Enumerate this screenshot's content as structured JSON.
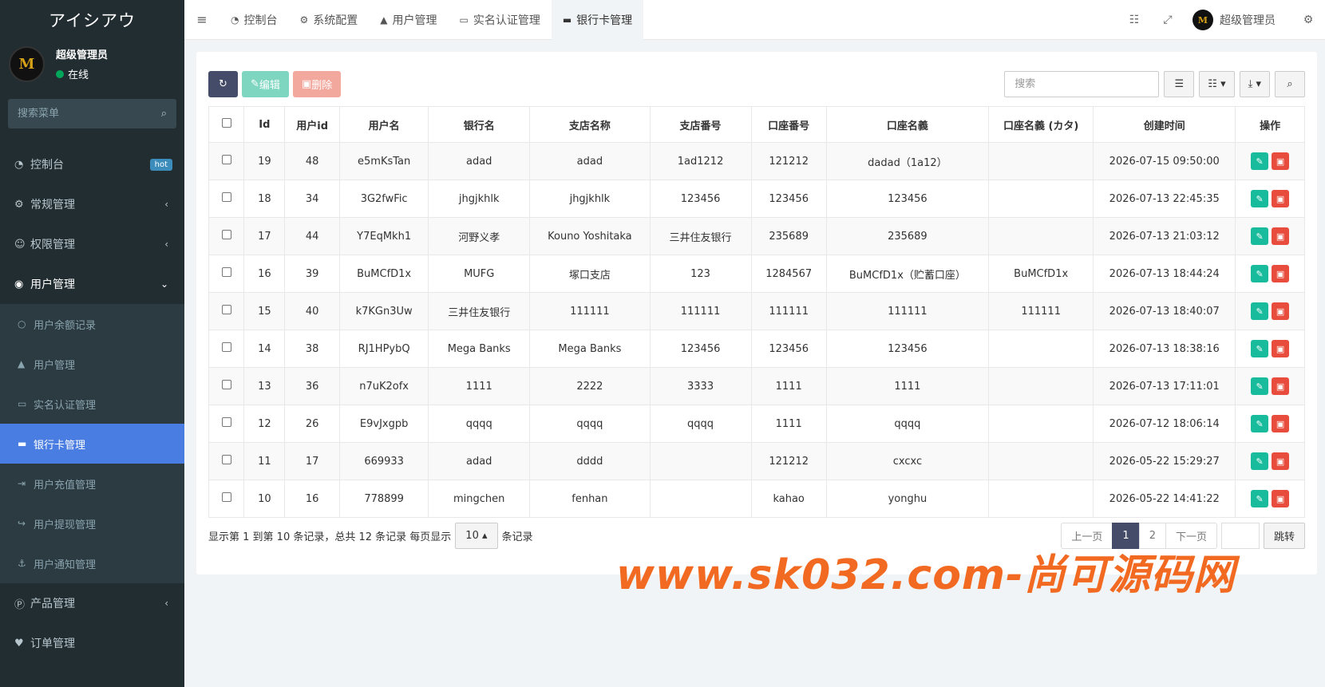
{
  "sidebar": {
    "brand": "アイシアウ",
    "avatar_text": "M",
    "user_name": "超级管理员",
    "user_status": "在线",
    "search_placeholder": "搜索菜单",
    "menu": {
      "dashboard": "控制台",
      "dashboard_badge": "hot",
      "general": "常规管理",
      "permission": "权限管理",
      "user_mgmt": "用户管理",
      "sub": {
        "balance": "用户余额记录",
        "users": "用户管理",
        "realname": "实名认证管理",
        "bankcard": "银行卡管理",
        "recharge": "用户充值管理",
        "withdraw": "用户提现管理",
        "notify": "用户通知管理"
      },
      "product": "产品管理",
      "orders": "订单管理"
    }
  },
  "navbar": {
    "tabs": [
      "控制台",
      "系统配置",
      "用户管理",
      "实名认证管理",
      "银行卡管理"
    ],
    "user_name": "超级管理员"
  },
  "toolbar": {
    "edit_label": "编辑",
    "delete_label": "删除",
    "search_placeholder": "搜索"
  },
  "table": {
    "headers": [
      "Id",
      "用户id",
      "用户名",
      "银行名",
      "支店名称",
      "支店番号",
      "口座番号",
      "口座名義",
      "口座名義 (カタ)",
      "创建时间",
      "操作"
    ],
    "rows": [
      [
        "19",
        "48",
        "e5mKsTan",
        "adad",
        "adad",
        "1ad1212",
        "121212",
        "dadad（1a12）",
        "",
        "2026-07-15 09:50:00"
      ],
      [
        "18",
        "34",
        "3G2fwFic",
        "jhgjkhlk",
        "jhgjkhlk",
        "123456",
        "123456",
        "123456",
        "",
        "2026-07-13 22:45:35"
      ],
      [
        "17",
        "44",
        "Y7EqMkh1",
        "河野义孝",
        "Kouno Yoshitaka",
        "三井住友银行",
        "235689",
        "235689",
        "",
        "2026-07-13 21:03:12"
      ],
      [
        "16",
        "39",
        "BuMCfD1x",
        "MUFG",
        "塚口支店",
        "123",
        "1284567",
        "BuMCfD1x（贮蓄口座）",
        "BuMCfD1x",
        "2026-07-13 18:44:24"
      ],
      [
        "15",
        "40",
        "k7KGn3Uw",
        "三井住友银行",
        "111111",
        "111111",
        "111111",
        "111111",
        "111111",
        "2026-07-13 18:40:07"
      ],
      [
        "14",
        "38",
        "RJ1HPybQ",
        "Mega Banks",
        "Mega Banks",
        "123456",
        "123456",
        "123456",
        "",
        "2026-07-13 18:38:16"
      ],
      [
        "13",
        "36",
        "n7uK2ofx",
        "1111",
        "2222",
        "3333",
        "1111",
        "1111",
        "",
        "2026-07-13 17:11:01"
      ],
      [
        "12",
        "26",
        "E9vJxgpb",
        "qqqq",
        "qqqq",
        "qqqq",
        "1111",
        "qqqq",
        "",
        "2026-07-12 18:06:14"
      ],
      [
        "11",
        "17",
        "669933",
        "adad",
        "dddd",
        "",
        "121212",
        "cxcxc",
        "",
        "2026-05-22 15:29:27"
      ],
      [
        "10",
        "16",
        "778899",
        "mingchen",
        "fenhan",
        "",
        "kahao",
        "yonghu",
        "",
        "2026-05-22 14:41:22"
      ]
    ]
  },
  "footer": {
    "info_prefix": "显示第 1 到第 10 条记录，总共 12 条记录 每页显示",
    "page_size": "10",
    "info_suffix": "条记录",
    "prev": "上一页",
    "pages": [
      "1",
      "2"
    ],
    "next": "下一页",
    "jump": "跳转"
  },
  "watermark": "www.sk032.com-尚可源码网",
  "colors": {
    "sidebar_bg": "#222d32",
    "active_menu": "#4a7de2",
    "primary_dark": "#444c69",
    "success": "#18bc9c",
    "danger": "#e74c3c",
    "watermark": "#f26a21"
  },
  "icons": {
    "dashboard": "dashboard-icon",
    "cogs": "cogs-icon",
    "users": "users-icon",
    "user_circle": "user-circle-icon",
    "credit_card": "credit-card-icon"
  }
}
